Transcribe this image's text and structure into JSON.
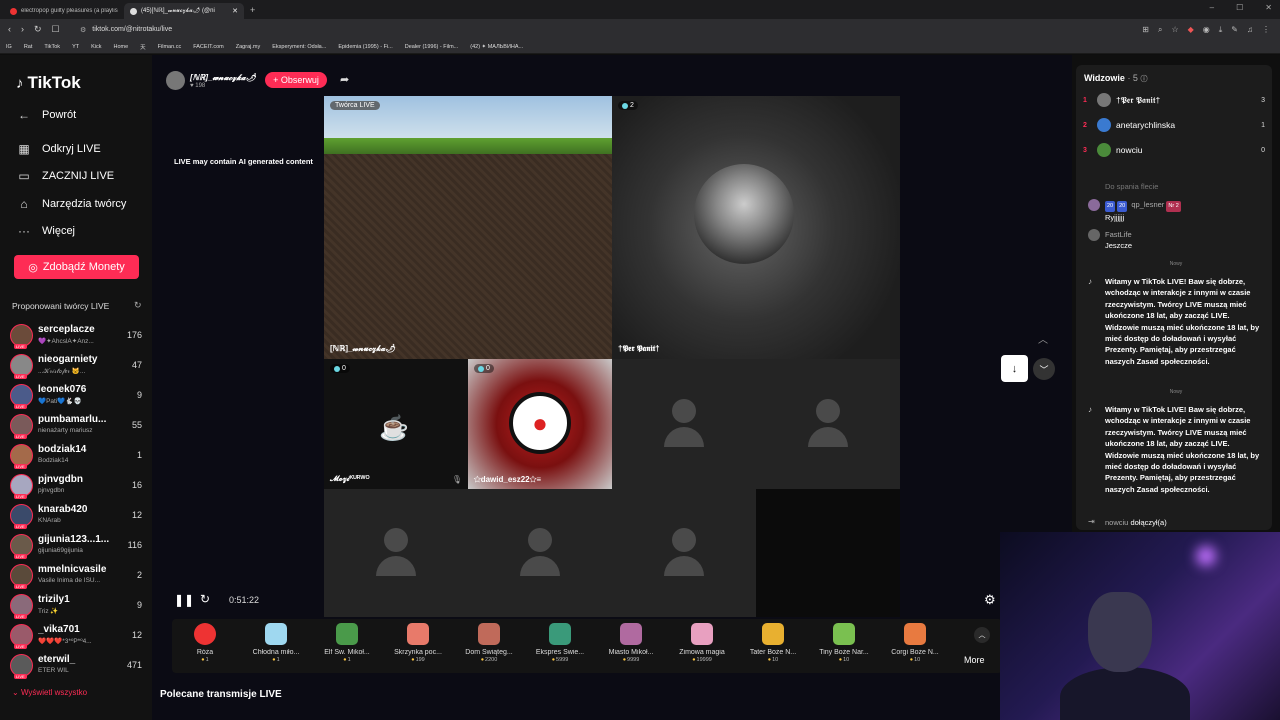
{
  "browser": {
    "tabs": [
      {
        "title": "electropop guilty pleasures (a playlis",
        "color": "#e33"
      },
      {
        "title": "(45)[ℕℝ]_𝔀𝓷𝓾𝓬𝔃𝓴𝓪🌶 (@ni",
        "color": "#ddd"
      }
    ],
    "url": "tiktok.com/@nitrotaku/live",
    "bookmarks": [
      "IG",
      "Rat",
      "TikTok",
      "YT",
      "Kick",
      "Home",
      "天",
      "Filman.cc",
      "FACEIT.com",
      "Zagraj.my",
      "Eksperyment: Odsła...",
      "Epidemia (1995) - Fi...",
      "Dealer (1996) - Film...",
      "(42) ✦ МАЛЬВИНА..."
    ]
  },
  "sidebar": {
    "logo": "TikTok",
    "nav": [
      {
        "label": "Powrót",
        "icon": "arrow-left-icon"
      },
      {
        "label": "Odkryj LIVE",
        "icon": "calendar-icon"
      },
      {
        "label": "ZACZNIJ LIVE",
        "icon": "video-icon"
      },
      {
        "label": "Narzędzia twórcy",
        "icon": "home-icon"
      },
      {
        "label": "Więcej",
        "icon": "more-icon"
      }
    ],
    "coins_button": "Zdobądź Monety",
    "proposed_title": "Proponowani twórcy LIVE",
    "creators": [
      {
        "name": "serceplacze",
        "sub": "💜✦AhcslA✦Anz...",
        "count": "176",
        "color": "#6b4b3a"
      },
      {
        "name": "nieogarniety",
        "sub": "...𝒦𝓇𝒾𝓈𝓉𝑜𝒻𝑒𝓇 🐱...",
        "count": "47",
        "color": "#888"
      },
      {
        "name": "leonek076",
        "sub": "💙Pati💙🐇💀",
        "count": "9",
        "color": "#4b5b8a"
      },
      {
        "name": "pumbamarlu...",
        "sub": "nienażarty mariusz",
        "count": "55",
        "color": "#7a5a5a"
      },
      {
        "name": "bodziak14",
        "sub": "Bodziak14",
        "count": "1",
        "color": "#a46a4a"
      },
      {
        "name": "pjnvgdbn",
        "sub": "pjnvgdbn",
        "count": "16",
        "color": "#a7a7c0"
      },
      {
        "name": "knarab420",
        "sub": "KNArab",
        "count": "12",
        "color": "#3a4a6a"
      },
      {
        "name": "gijunia123...1...",
        "sub": "gijunia69gijunia",
        "count": "116",
        "color": "#6a5a4a"
      },
      {
        "name": "mmelnicvasile",
        "sub": "Vasile Inima de ISU...",
        "count": "2",
        "color": "#5a4a3a"
      },
      {
        "name": "trizily1",
        "sub": "Triz ✨",
        "count": "9",
        "color": "#8a6a7a"
      },
      {
        "name": "_vika701",
        "sub": "❤️❤️❤️*3*ºP*º4...",
        "count": "12",
        "color": "#9a5a6a"
      },
      {
        "name": "eterwil_",
        "sub": "ETER WIL",
        "count": "471",
        "color": "#5a5a5a"
      }
    ],
    "see_all": "Wyświetl wszystko"
  },
  "main": {
    "host_name": "[ℕℝ]_𝔀𝓷𝓾𝓬𝔃𝓴𝓪🌶",
    "host_likes": "♥ 198",
    "follow_label": "+ Obserwuj",
    "ai_note": "LIVE may contain AI generated content",
    "creator_live_label": "Twórca LIVE",
    "cells": {
      "host_name": "[ℕℝ]_𝔀𝓷𝓾𝓬𝔃𝓴𝓪🌶",
      "guest1_badge": "2",
      "guest1_name": "†𝕻𝖊𝖗 𝕻𝖆𝖓𝖎𝖙†",
      "guest2_badge": "0",
      "guest2_name": "𝓜𝓸𝔃𝓲ᴷᵁᴿᵂᴼ",
      "guest3_badge": "0",
      "guest3_name": "✩dawid_esz22✩≡"
    },
    "time": "0:51:22",
    "gifts": [
      {
        "name": "Róża",
        "price": "1",
        "color": "#e33"
      },
      {
        "name": "Chłodna miło...",
        "price": "1",
        "color": "#9fd8f0"
      },
      {
        "name": "Elf Św. Mikoł...",
        "price": "1",
        "color": "#4a9a4a"
      },
      {
        "name": "Skrzynka poc...",
        "price": "199",
        "color": "#e87a6a"
      },
      {
        "name": "Dom Świąteg...",
        "price": "2200",
        "color": "#c06a5a"
      },
      {
        "name": "Ekspres Świe...",
        "price": "5999",
        "color": "#3a9a7a"
      },
      {
        "name": "Miasto Mikoł...",
        "price": "9999",
        "color": "#b06aa0"
      },
      {
        "name": "Zimowa magia",
        "price": "19999",
        "color": "#e8a0c0"
      },
      {
        "name": "Tater Boże N...",
        "price": "10",
        "color": "#e8b030"
      },
      {
        "name": "Tiny Boże Nar...",
        "price": "10",
        "color": "#7ac050"
      },
      {
        "name": "Corgi Boże N...",
        "price": "10",
        "color": "#e87a40"
      }
    ],
    "more_label": "More",
    "recommended_title": "Polecane transmisje LIVE"
  },
  "chat": {
    "viewers_title": "Widzowie",
    "viewers_count": "· 5",
    "viewers": [
      {
        "rank": "1",
        "name": "†𝕻𝖊𝖗 𝕻𝖆𝖓𝖎𝖙†",
        "score": "3",
        "color": "#777"
      },
      {
        "rank": "2",
        "name": "anetarychlinska",
        "score": "1",
        "color": "#3a7ad0"
      },
      {
        "rank": "3",
        "name": "nowciu",
        "score": "0",
        "color": "#4a8a3a"
      }
    ],
    "faded_msg": "Do spania flecie",
    "msg1_badges": [
      "20",
      "20"
    ],
    "msg1_user": "qp_lesner",
    "msg1_tag": "Nr 2",
    "msg1_text": "Ryjjjjjj",
    "msg2_user": "FastLife",
    "msg2_text": "Jeszcze",
    "new_label": "Nowy",
    "system_text": "Witamy w TikTok LIVE! Baw się dobrze, wchodząc w interakcje z innymi w czasie rzeczywistym. Twórcy LIVE muszą mieć ukończone 18 lat, aby zacząć LIVE. Widzowie muszą mieć ukończone 18 lat, by mieć dostęp do doładowań i wysyłać Prezenty. Pamiętaj, aby przestrzegać naszych Zasad społeczności.",
    "join_user": "nowciu",
    "join_text": "dołączył(a)"
  }
}
